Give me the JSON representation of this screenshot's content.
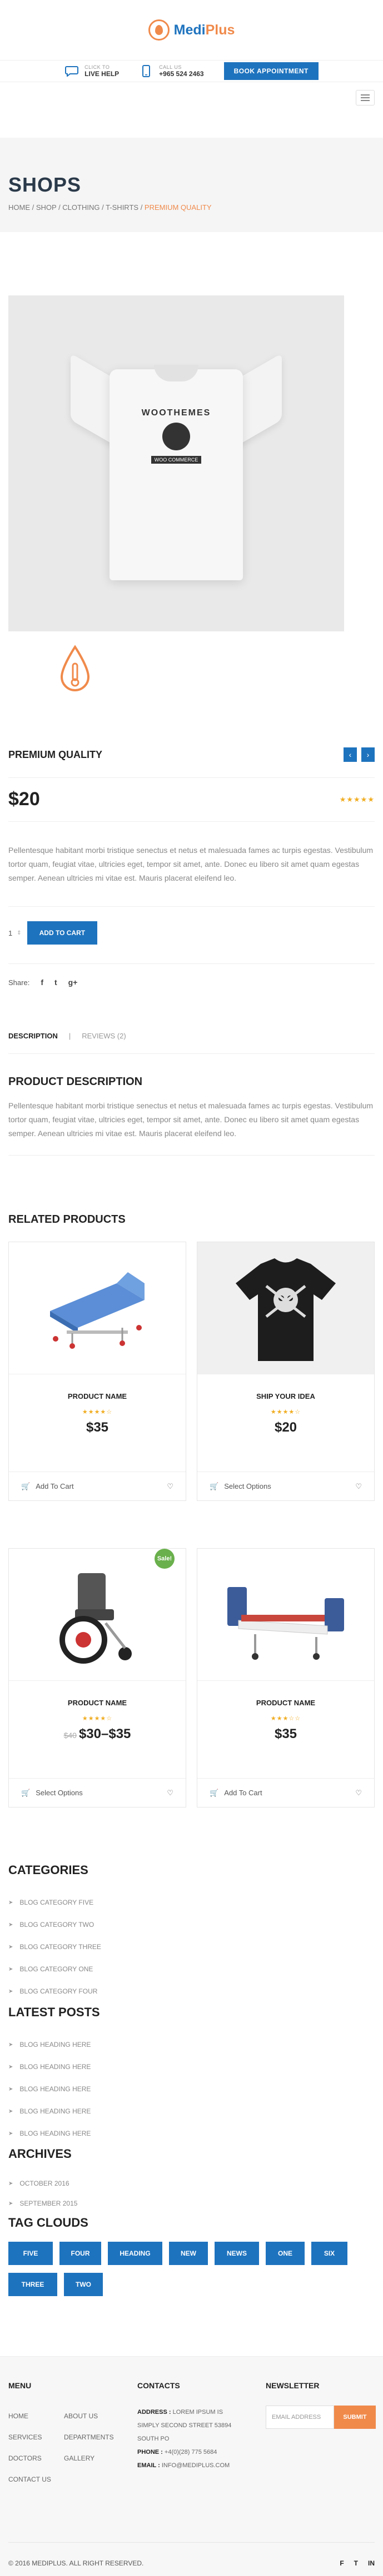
{
  "header": {
    "logo_text_main": "Medi",
    "logo_text_accent": "Plus",
    "live_help_small": "CLICK TO",
    "live_help_big": "LIVE HELP",
    "call_small": "CALL US",
    "call_big": "+965 524 2463",
    "appointment_button": "BOOK APPOINTMENT"
  },
  "page_title": {
    "heading": "SHOPS",
    "breadcrumb": [
      "HOME",
      "SHOP",
      "CLOTHING",
      "T-SHIRTS"
    ],
    "breadcrumb_current": "PREMIUM QUALITY",
    "separator": " / "
  },
  "product": {
    "shirt_print_top": "WOOTHEMES",
    "shirt_print_bottom": "WOO COMMERCE",
    "name": "PREMIUM QUALITY",
    "prev_arrow": "‹",
    "next_arrow": "›",
    "price": "$20",
    "rating_stars": "★★★★★",
    "description": "Pellentesque habitant morbi tristique senectus et netus et malesuada fames ac turpis egestas. Vestibulum tortor quam, feugiat vitae, ultricies eget, tempor sit amet, ante. Donec eu libero sit amet quam egestas semper. Aenean ultricies mi vitae est. Mauris placerat eleifend leo.",
    "quantity": "1",
    "add_to_cart": "ADD TO CART",
    "share_label": "Share:",
    "share_icons": [
      "f",
      "t",
      "g+"
    ]
  },
  "tabs": {
    "active": "DESCRIPTION",
    "separator": "|",
    "reviews": "REVIEWS (2)"
  },
  "description_section": {
    "title": "PRODUCT DESCRIPTION",
    "text": "Pellentesque habitant morbi tristique senectus et netus et malesuada fames ac turpis egestas. Vestibulum tortor quam, feugiat vitae, ultricies eget, tempor sit amet, ante. Donec eu libero sit amet quam egestas semper. Aenean ultricies mi vitae est. Mauris placerat eleifend leo."
  },
  "related": {
    "title": "RELATED PRODUCTS",
    "items": [
      {
        "name": "PRODUCT NAME",
        "stars": "★★★★☆",
        "price": "$35",
        "old_price": "",
        "action": "Add To Cart",
        "sale": ""
      },
      {
        "name": "SHIP YOUR IDEA",
        "stars": "★★★★☆",
        "price": "$20",
        "old_price": "",
        "action": "Select Options",
        "sale": ""
      },
      {
        "name": "PRODUCT NAME",
        "stars": "★★★★☆",
        "price": "$30–$35",
        "old_price": "$40",
        "action": "Select Options",
        "sale": "Sale!"
      },
      {
        "name": "PRODUCT NAME",
        "stars": "★★★☆☆",
        "price": "$35",
        "old_price": "",
        "action": "Add To Cart",
        "sale": ""
      }
    ]
  },
  "categories": {
    "title": "CATEGORIES",
    "items": [
      "BLOG CATEGORY FIVE",
      "BLOG CATEGORY TWO",
      "BLOG CATEGORY THREE",
      "BLOG CATEGORY ONE",
      "BLOG CATEGORY FOUR"
    ]
  },
  "latest_posts": {
    "title": "LATEST POSTS",
    "items": [
      "BLOG HEADING HERE",
      "BLOG HEADING HERE",
      "BLOG HEADING HERE",
      "BLOG HEADING HERE",
      "BLOG HEADING HERE"
    ]
  },
  "archives": {
    "title": "ARCHIVES",
    "items": [
      "OCTOBER 2016",
      "SEPTEMBER 2015"
    ]
  },
  "tag_clouds": {
    "title": "TAG CLOUDS",
    "tags": [
      "FIVE",
      "FOUR",
      "HEADING",
      "NEW",
      "NEWS",
      "ONE",
      "SIX",
      "THREE",
      "TWO"
    ]
  },
  "footer": {
    "menu_title": "MENU",
    "menu_items": [
      "HOME",
      "ABOUT US",
      "SERVICES",
      "DEPARTMENTS",
      "DOCTORS",
      "GALLERY",
      "CONTACT US"
    ],
    "contacts_title": "CONTACTS",
    "address_label": "ADDRESS :",
    "address_value": "LOREM IPSUM IS SIMPLY SECOND STREET 53894 SOUTH PO",
    "phone_label": "PHONE :",
    "phone_value": "+4(0)(28) 775 5684",
    "email_label": "EMAIL :",
    "email_value": "INFO@MEDIPLUS.COM",
    "newsletter_title": "NEWSLETTER",
    "newsletter_placeholder": "EMAIL ADDRESS",
    "newsletter_button": "SUBMIT",
    "copyright": "© 2016 MEDIPLUS. ALL RIGHT RESERVED.",
    "social_icons": [
      "f",
      "t",
      "in"
    ]
  },
  "colors": {
    "brand_blue": "#1e73be",
    "accent_orange": "#f08a4b",
    "star_gold": "#f0ad22",
    "sale_green": "#6ab04c"
  }
}
